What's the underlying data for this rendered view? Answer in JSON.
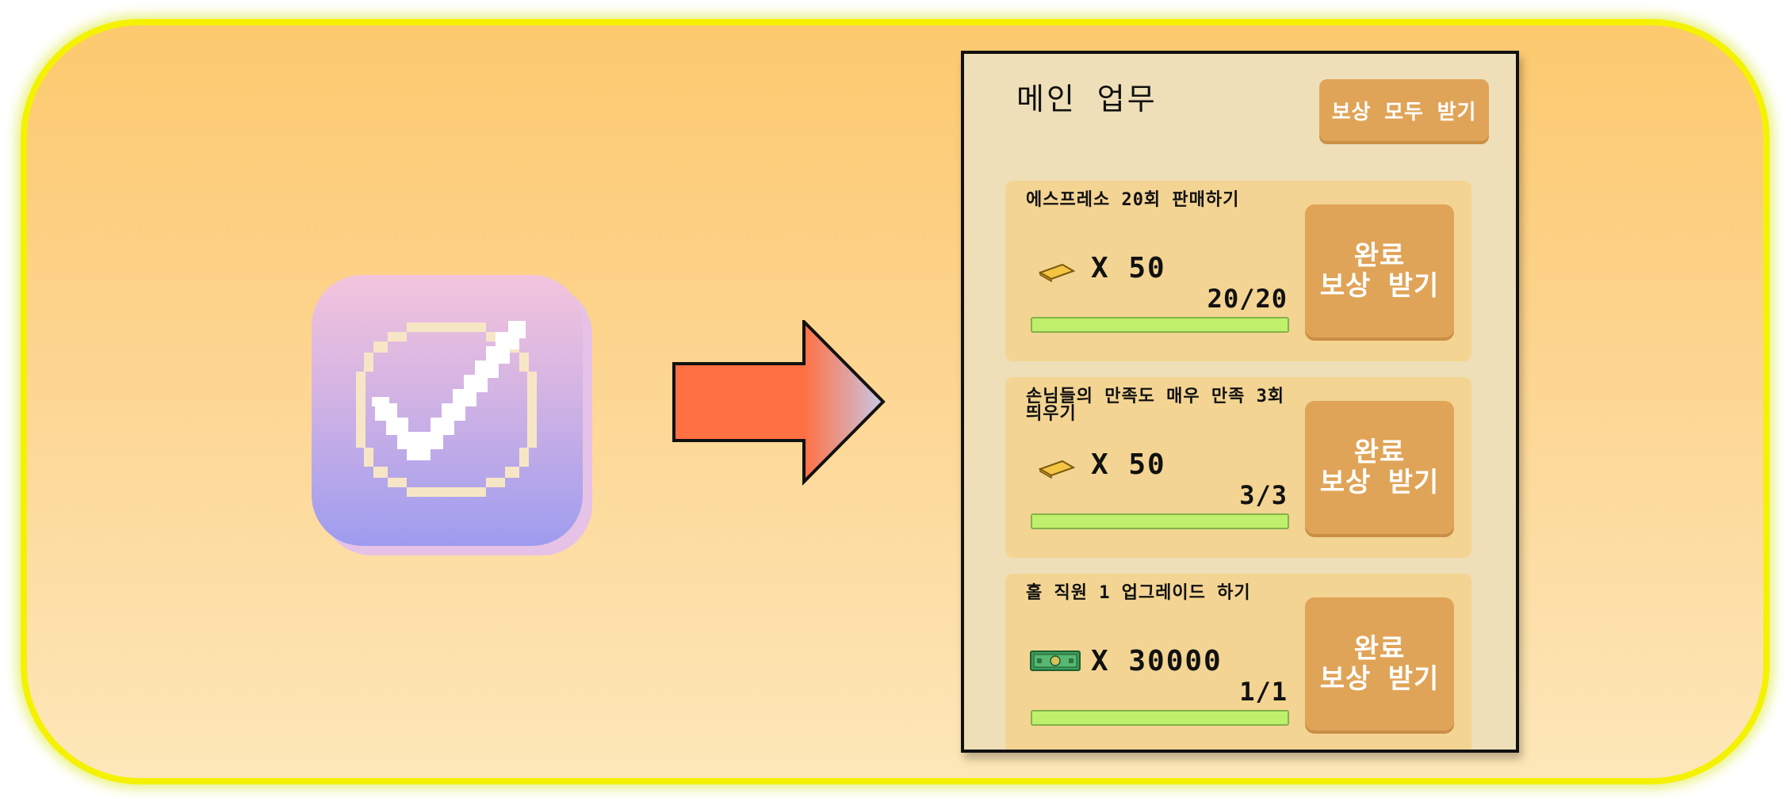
{
  "panel": {
    "title": "메인 업무",
    "claim_all_label": "보상 모두 받기"
  },
  "quests": [
    {
      "title": "에스프레소 20회 판매하기",
      "reward_icon": "gold-bar-icon",
      "reward_text": "X 50",
      "progress_text": "20/20",
      "progress_fraction": 1.0,
      "button_line1": "완료",
      "button_line2": "보상 받기"
    },
    {
      "title": "손님들의 만족도 매우 만족 3회 띄우기",
      "reward_icon": "gold-bar-icon",
      "reward_text": "X 50",
      "progress_text": "3/3",
      "progress_fraction": 1.0,
      "button_line1": "완료",
      "button_line2": "보상 받기"
    },
    {
      "title": "홀 직원 1 업그레이드 하기",
      "reward_icon": "cash-icon",
      "reward_text": "X 30000",
      "progress_text": "1/1",
      "progress_fraction": 1.0,
      "button_line1": "완료",
      "button_line2": "보상 받기"
    }
  ],
  "colors": {
    "frame_border": "#f4f200",
    "button": "#e0a458",
    "progress_fill": "#bff06c",
    "arrow": "#ff7043"
  }
}
